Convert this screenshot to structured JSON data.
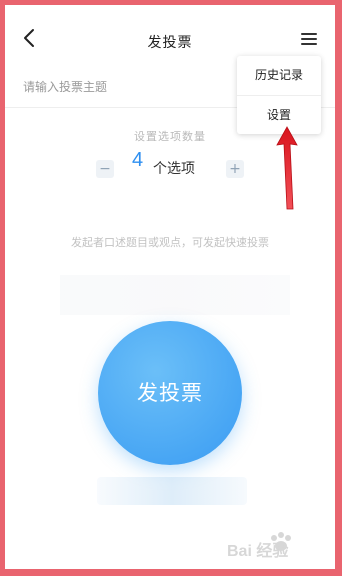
{
  "header": {
    "title": "发投票",
    "back_icon": "back-chevron-icon",
    "menu_icon": "hamburger-menu-icon"
  },
  "topic": {
    "placeholder": "请输入投票主题",
    "value": ""
  },
  "options": {
    "label": "设置选项数量",
    "count": "4",
    "unit": "个选项",
    "minus_icon": "minus-icon",
    "plus_icon": "plus-icon"
  },
  "hint": "发起者口述题目或观点，可发起快速投票",
  "vote_button": {
    "label": "发投票",
    "color": "#48a6f4"
  },
  "dropdown": {
    "items": [
      {
        "label": "历史记录"
      },
      {
        "label": "设置"
      }
    ]
  },
  "annotation": {
    "arrow_color": "#e8232b"
  },
  "watermark": {
    "text": "Bai 经验"
  },
  "colors": {
    "frame": "#e9646f",
    "accent": "#2e8ff0"
  }
}
